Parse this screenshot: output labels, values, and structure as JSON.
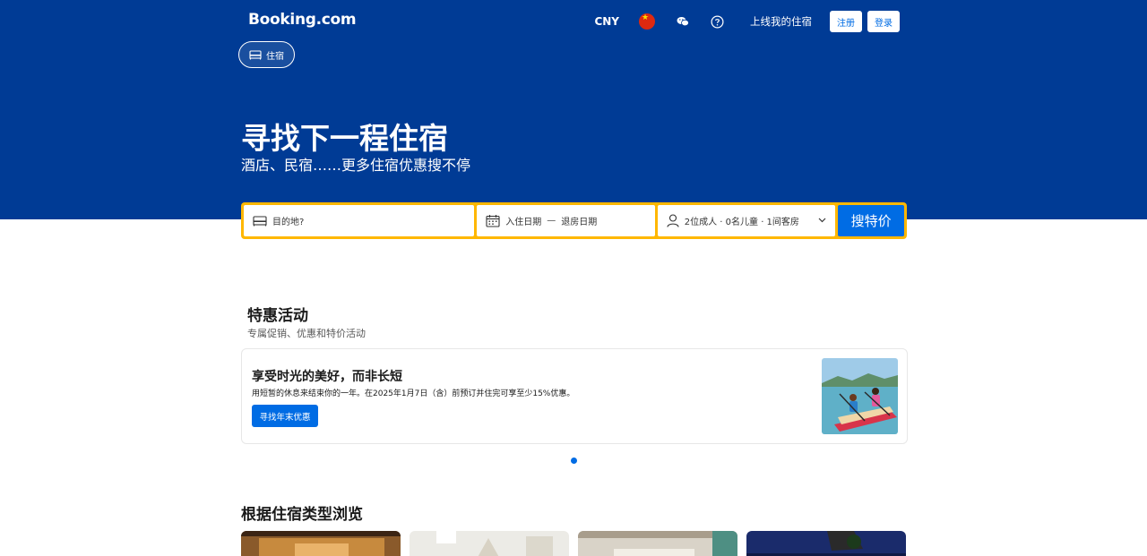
{
  "header": {
    "logo": "Booking.com",
    "currency": "CNY",
    "flag_icon": "china-flag-icon",
    "chat_icon": "wechat-icon",
    "help_icon": "help-circle-icon",
    "list_property": "上线我的住宿",
    "register": "注册",
    "login": "登录"
  },
  "tabs": [
    {
      "label": "住宿",
      "icon": "bed-icon",
      "active": true
    }
  ],
  "hero": {
    "title": "寻找下一程住宿",
    "subtitle": "酒店、民宿……更多住宿优惠搜不停"
  },
  "search": {
    "destination_placeholder": "目的地?",
    "checkin": "入住日期",
    "separator": "—",
    "checkout": "退房日期",
    "guests": "2位成人 · 0名儿童 · 1间客房",
    "button": "搜特价"
  },
  "offers": {
    "title": "特惠活动",
    "subtitle": "专属促销、优惠和特价活动",
    "card": {
      "title": "享受时光的美好，而非长短",
      "description": "用短暂的休息来结束你的一年。在2025年1月7日（含）前预订并住完可享至少15%优惠。",
      "button": "寻找年末优惠"
    },
    "carousel_count": 1,
    "carousel_active": 1
  },
  "browse": {
    "title": "根据住宿类型浏览"
  },
  "colors": {
    "brand_blue": "#003b95",
    "accent_blue": "#006ce4",
    "search_border": "#ffb700"
  }
}
